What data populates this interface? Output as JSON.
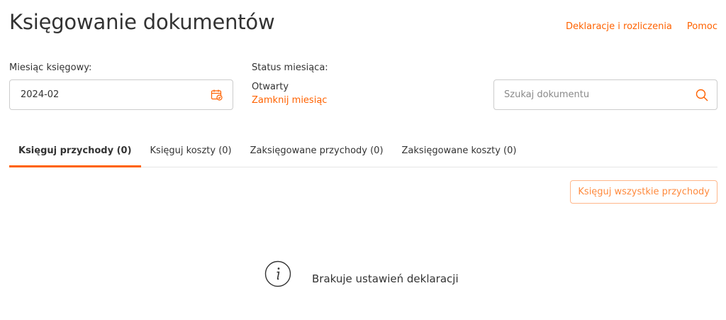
{
  "header": {
    "title": "Księgowanie dokumentów",
    "links": [
      {
        "label": "Deklaracje i rozliczenia"
      },
      {
        "label": "Pomoc"
      }
    ]
  },
  "filters": {
    "month_label": "Miesiąc księgowy:",
    "month_value": "2024-02",
    "status_label": "Status miesiąca:",
    "status_value": "Otwarty",
    "close_month_label": "Zamknij miesiąc",
    "search_placeholder": "Szukaj dokumentu",
    "search_value": ""
  },
  "tabs": [
    {
      "label": "Księguj przychody (0)",
      "active": true
    },
    {
      "label": "Księguj koszty (0)",
      "active": false
    },
    {
      "label": "Zaksięgowane przychody (0)",
      "active": false
    },
    {
      "label": "Zaksięgowane koszty (0)",
      "active": false
    }
  ],
  "actions": {
    "post_all_label": "Księguj wszystkie przychody"
  },
  "empty_state": {
    "message": "Brakuje ustawień deklaracji"
  },
  "icons": {
    "calendar": "calendar-icon",
    "search": "search-icon",
    "info": "info-icon"
  },
  "colors": {
    "accent": "#ff6200",
    "text": "#333333",
    "border": "#cccccc",
    "button_border": "#ffb78a"
  }
}
